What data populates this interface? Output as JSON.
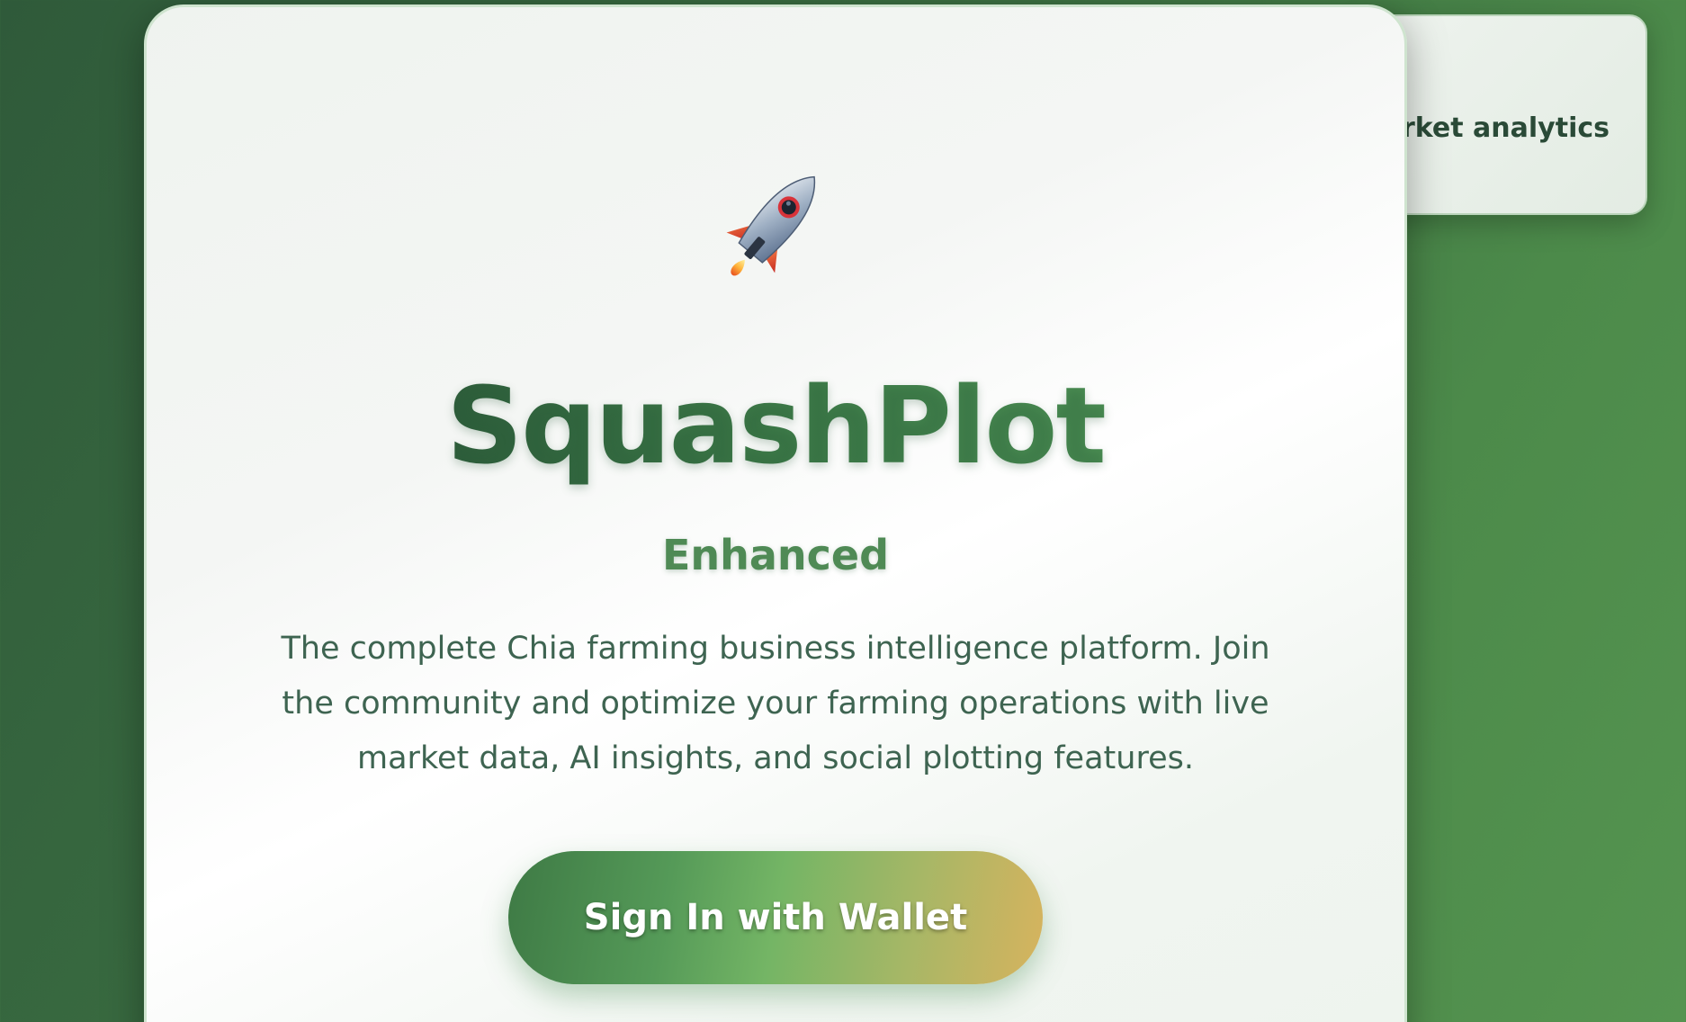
{
  "side_card": {
    "text": "arket analytics"
  },
  "hero": {
    "icon": "rocket-icon",
    "title": "SquashPlot",
    "subtitle": "Enhanced",
    "description": "The complete Chia farming business intelligence platform. Join the community and optimize your farming operations with live market data, AI insights, and social plotting features.",
    "cta_label": "Sign In with Wallet"
  },
  "colors": {
    "background": "#3c7042",
    "accent_green": "#3b7648",
    "cta_gradient_start": "#3e7a45",
    "cta_gradient_end": "#d7b35e"
  }
}
